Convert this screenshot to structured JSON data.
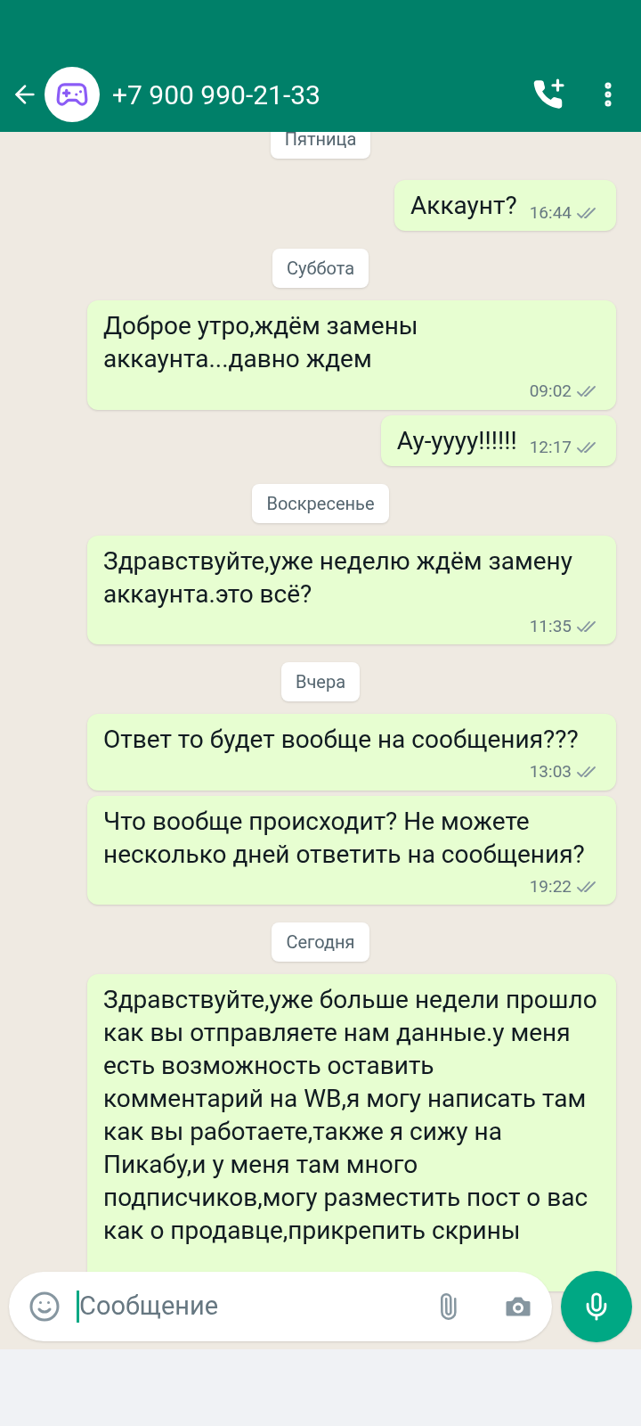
{
  "header": {
    "title": "+7 900 990-21-33"
  },
  "messages": [
    {
      "kind": "date",
      "text": "Пятница"
    },
    {
      "kind": "outgoing",
      "text": "Аккаунт?",
      "time": "16:44",
      "read": false
    },
    {
      "kind": "date",
      "text": "Суббота"
    },
    {
      "kind": "outgoing",
      "text": "Доброе утро,ждём замены аккаунта...давно ждем",
      "time": "09:02",
      "read": false
    },
    {
      "kind": "outgoing",
      "text": "Ау-уууу!!!!!!",
      "time": "12:17",
      "read": false
    },
    {
      "kind": "date",
      "text": "Воскресенье"
    },
    {
      "kind": "outgoing",
      "text": "Здравствуйте,уже неделю ждём замену аккаунта.это всё?",
      "time": "11:35",
      "read": false
    },
    {
      "kind": "date",
      "text": "Вчера"
    },
    {
      "kind": "outgoing",
      "text": "Ответ то будет вообще на сообщения???",
      "time": "13:03",
      "read": false
    },
    {
      "kind": "outgoing",
      "text": "Что вообще происходит? Не можете несколько дней ответить на сообщения?",
      "time": "19:22",
      "read": false
    },
    {
      "kind": "date",
      "text": "Сегодня"
    },
    {
      "kind": "outgoing",
      "text": "Здравствуйте,уже больше недели прошло как вы отправляете нам данные.у меня есть возможность оставить комментарий на WB,я могу написать там как вы работаете,также я сижу на Пикабу,и у меня там много подписчиков,могу разместить пост о вас как о продавце,прикрепить скрины"
    }
  ],
  "composer": {
    "placeholder": "Сообщение"
  }
}
